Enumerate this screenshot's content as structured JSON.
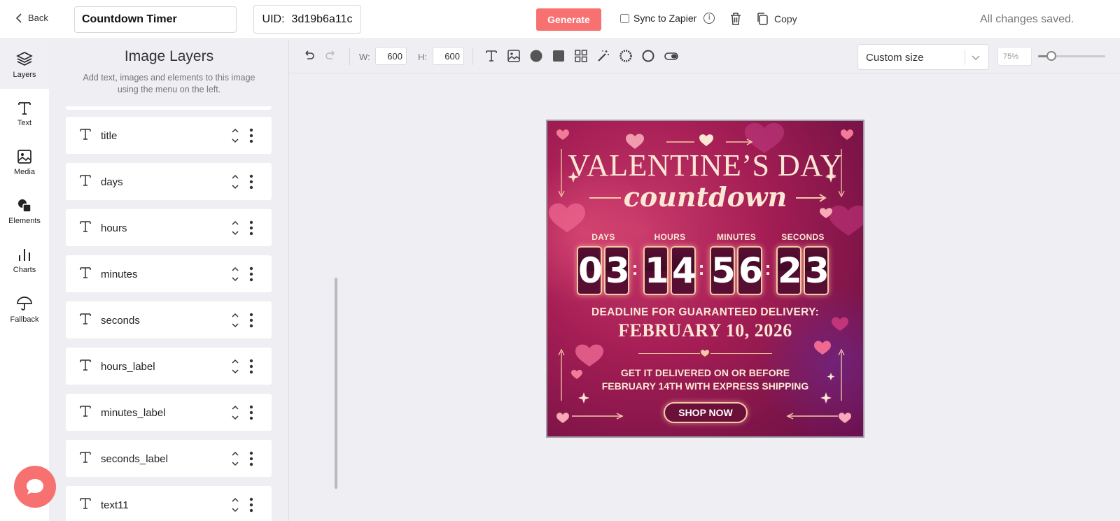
{
  "header": {
    "back_label": "Back",
    "timer_name": "Countdown Timer",
    "uid_label": "UID:",
    "uid_value": "3d19b6a11c",
    "generate_label": "Generate",
    "sync_label": "Sync to Zapier",
    "sync_checked": false,
    "copy_label": "Copy",
    "status": "All changes saved."
  },
  "rail": {
    "items": [
      {
        "label": "Layers",
        "icon": "layers-icon",
        "active": true
      },
      {
        "label": "Text",
        "icon": "text-icon"
      },
      {
        "label": "Media",
        "icon": "image-icon"
      },
      {
        "label": "Elements",
        "icon": "elements-icon"
      },
      {
        "label": "Charts",
        "icon": "bar-chart-icon"
      },
      {
        "label": "Fallback",
        "icon": "umbrella-icon"
      }
    ]
  },
  "panel": {
    "title": "Image Layers",
    "subtitle": "Add text, images and elements to this image using the menu on the left.",
    "layers": [
      {
        "name": "title"
      },
      {
        "name": "days"
      },
      {
        "name": "hours"
      },
      {
        "name": "minutes"
      },
      {
        "name": "seconds"
      },
      {
        "name": "hours_label"
      },
      {
        "name": "minutes_label"
      },
      {
        "name": "seconds_label"
      },
      {
        "name": "text11"
      }
    ]
  },
  "toolbar": {
    "width_label": "W:",
    "width_value": "600",
    "height_label": "H:",
    "height_value": "600",
    "size_option": "Custom size",
    "zoom": "75%",
    "zoom_fraction": 0.2
  },
  "poster": {
    "title_line1": "VALENTINE’S DAY",
    "title_line2": "countdown",
    "labels": [
      "DAYS",
      "HOURS",
      "MINUTES",
      "SECONDS"
    ],
    "digits": [
      "0",
      "3",
      "1",
      "4",
      "5",
      "6",
      "2",
      "3"
    ],
    "colon": ":",
    "deadline_label": "DEADLINE FOR GUARANTEED DELIVERY:",
    "deadline_date": "FEBRUARY 10, 2026",
    "line1": "GET IT DELIVERED ON OR BEFORE",
    "line2": "FEBRUARY 14TH WITH EXPRESS SHIPPING",
    "button": "SHOP NOW",
    "colors": {
      "background": "#a51e55",
      "text": "#fbe7d4",
      "digit_bg": "#4a0c2b"
    }
  },
  "colors": {
    "accent": "#f87171",
    "panel_bg": "#eeeef3"
  }
}
